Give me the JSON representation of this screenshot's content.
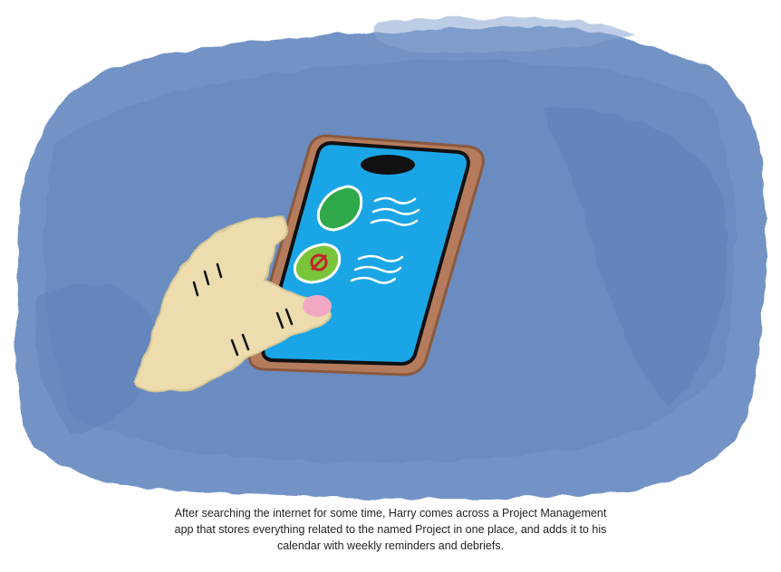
{
  "illustration": {
    "background_color": "#6f8fc4",
    "phone_case_color": "#b07a5a",
    "phone_screen_color": "#1aa6e6",
    "hand_color": "#ecdcae",
    "fingertip_color": "#f2a8c2",
    "app_icon_colors": [
      "#2fa84a",
      "#7ac43a"
    ],
    "icons": [
      "phone-camera-icon",
      "app-icon-green-leaf",
      "app-icon-project",
      "text-lines-icon"
    ]
  },
  "caption": {
    "line1": "After searching the internet for some time, Harry comes across a Project Management",
    "line2": "app that stores everything related to the named Project in one place, and adds it to his",
    "line3": "calendar with weekly reminders and debriefs."
  }
}
